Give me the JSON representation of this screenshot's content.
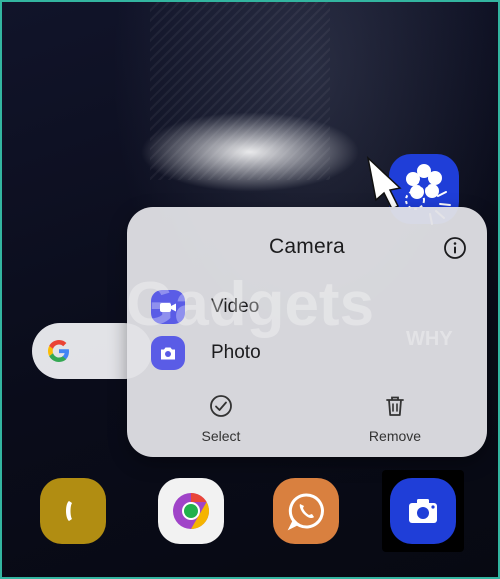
{
  "popup": {
    "title": "Camera",
    "items": [
      {
        "label": "Video",
        "icon": "video-icon"
      },
      {
        "label": "Photo",
        "icon": "photo-icon"
      }
    ],
    "actions": [
      {
        "label": "Select",
        "icon": "check-circle-icon"
      },
      {
        "label": "Remove",
        "icon": "trash-icon"
      }
    ]
  },
  "watermark": {
    "text": "Gadgets",
    "suffix": "WHY"
  },
  "dock": [
    {
      "name": "Phone",
      "icon": "phone-icon",
      "color": "#b18d12"
    },
    {
      "name": "Chrome",
      "icon": "chrome-icon",
      "color": "#f2f2f2"
    },
    {
      "name": "WhatsApp",
      "icon": "whatsapp-icon",
      "color": "#d9803f"
    },
    {
      "name": "Camera",
      "icon": "camera-icon",
      "color": "#1f3ed8"
    }
  ],
  "colors": {
    "accent": "#5a5ce6",
    "camera_blue": "#1f3ed8",
    "frame": "#33b5a0"
  }
}
